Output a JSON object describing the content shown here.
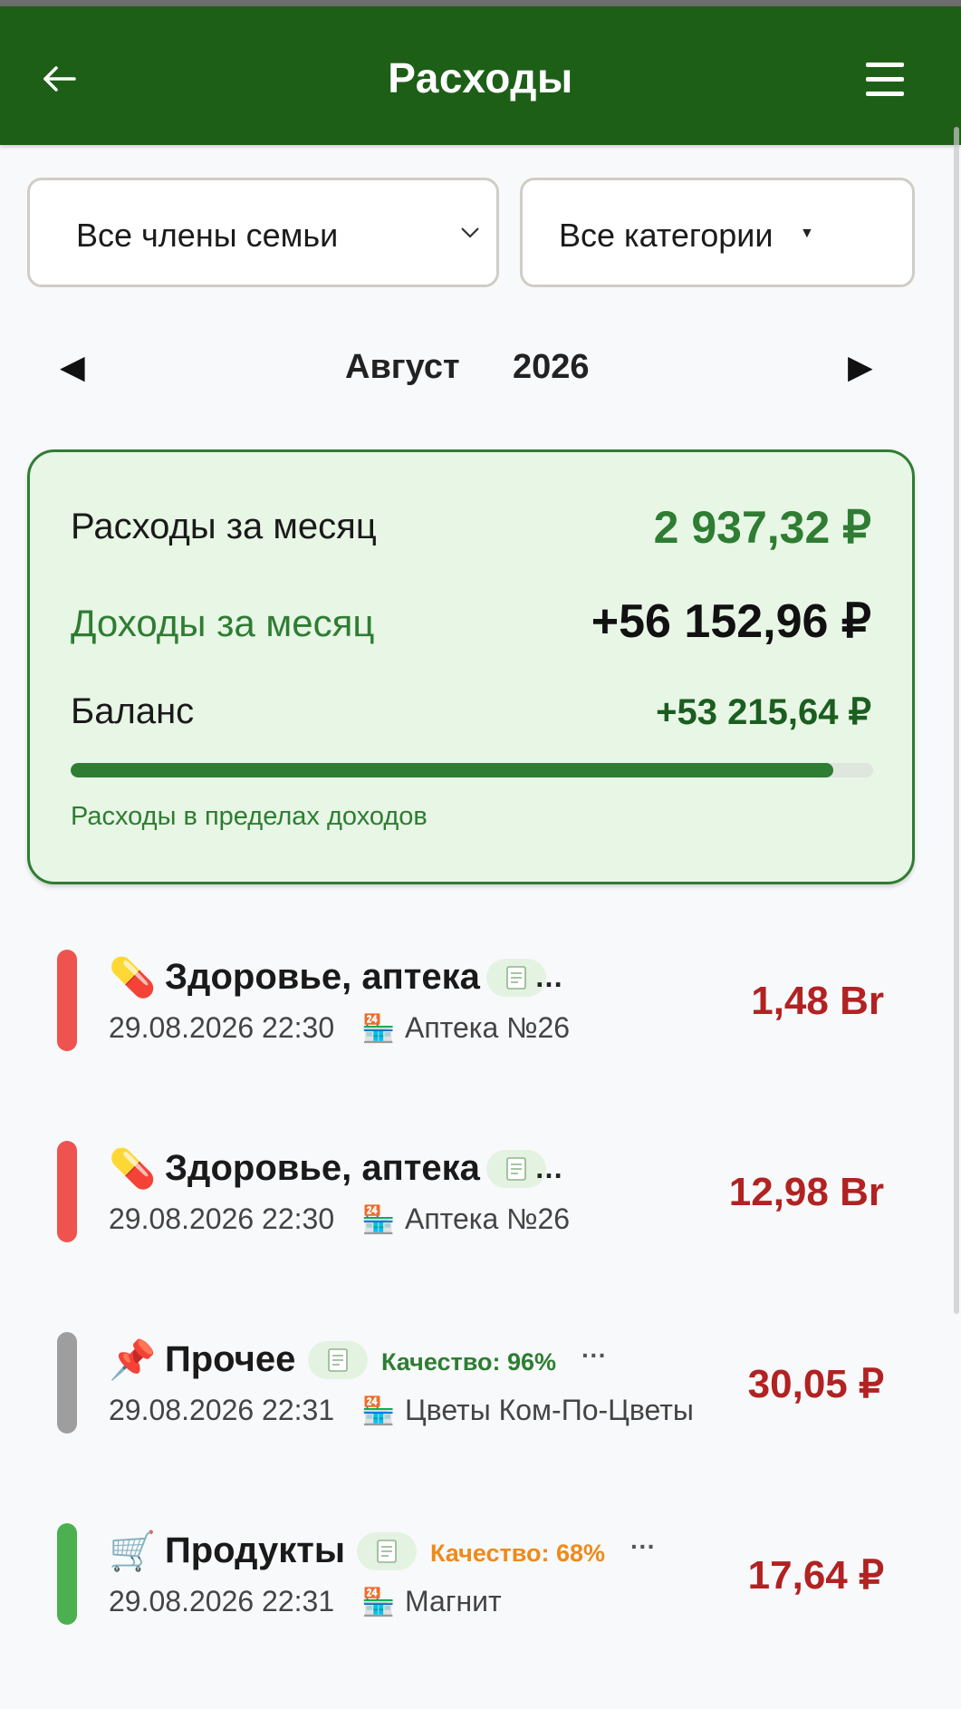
{
  "header": {
    "back_icon": "arrow-left-icon",
    "title": "Расходы",
    "menu_icon": "hamburger-menu-icon"
  },
  "filters": {
    "member": "Все члены семьи",
    "category": "Все категории"
  },
  "period": {
    "month": "Август",
    "year": "2026"
  },
  "summary": {
    "expenses_label": "Расходы за месяц",
    "expenses_value": "2 937,32 ₽",
    "income_label": "Доходы за месяц",
    "income_value": "+56 152,96 ₽",
    "balance_label": "Баланс",
    "balance_value": "+53 215,64 ₽",
    "progress_fraction": 0.95,
    "caption": "Расходы в пределах доходов",
    "colors": {
      "accent": "#2e7d32",
      "card_bg": "#e8f6e6",
      "header": "#1e5f17"
    }
  },
  "transactions": [
    {
      "category": "Здоровье, аптека",
      "emoji": "💊",
      "icon": "pill-icon",
      "color": "#ef5350",
      "truncated": "…",
      "date": "29.08.2026 22:30",
      "shop": "Аптека №26",
      "amount": "1,48 Br"
    },
    {
      "category": "Здоровье, аптека",
      "emoji": "💊",
      "icon": "pill-icon",
      "color": "#ef5350",
      "truncated": "…",
      "date": "29.08.2026 22:30",
      "shop": "Аптека №26",
      "amount": "12,98 Br"
    },
    {
      "category": "Прочее",
      "emoji": "📌",
      "icon": "pushpin-icon",
      "color": "#9e9e9e",
      "quality": "Качество: 96%",
      "quality_color": "#2e7d32",
      "more": "···",
      "date": "29.08.2026 22:31",
      "shop": "Цветы Ком-По-Цветы",
      "amount": "30,05 ₽"
    },
    {
      "category": "Продукты",
      "emoji": "🛒",
      "icon": "shopping-cart-icon",
      "color": "#4caf50",
      "quality": "Качество: 68%",
      "quality_color": "#ef8a1a",
      "more": "···",
      "date": "29.08.2026 22:31",
      "shop": "Магнит",
      "amount": "17,64 ₽"
    }
  ]
}
